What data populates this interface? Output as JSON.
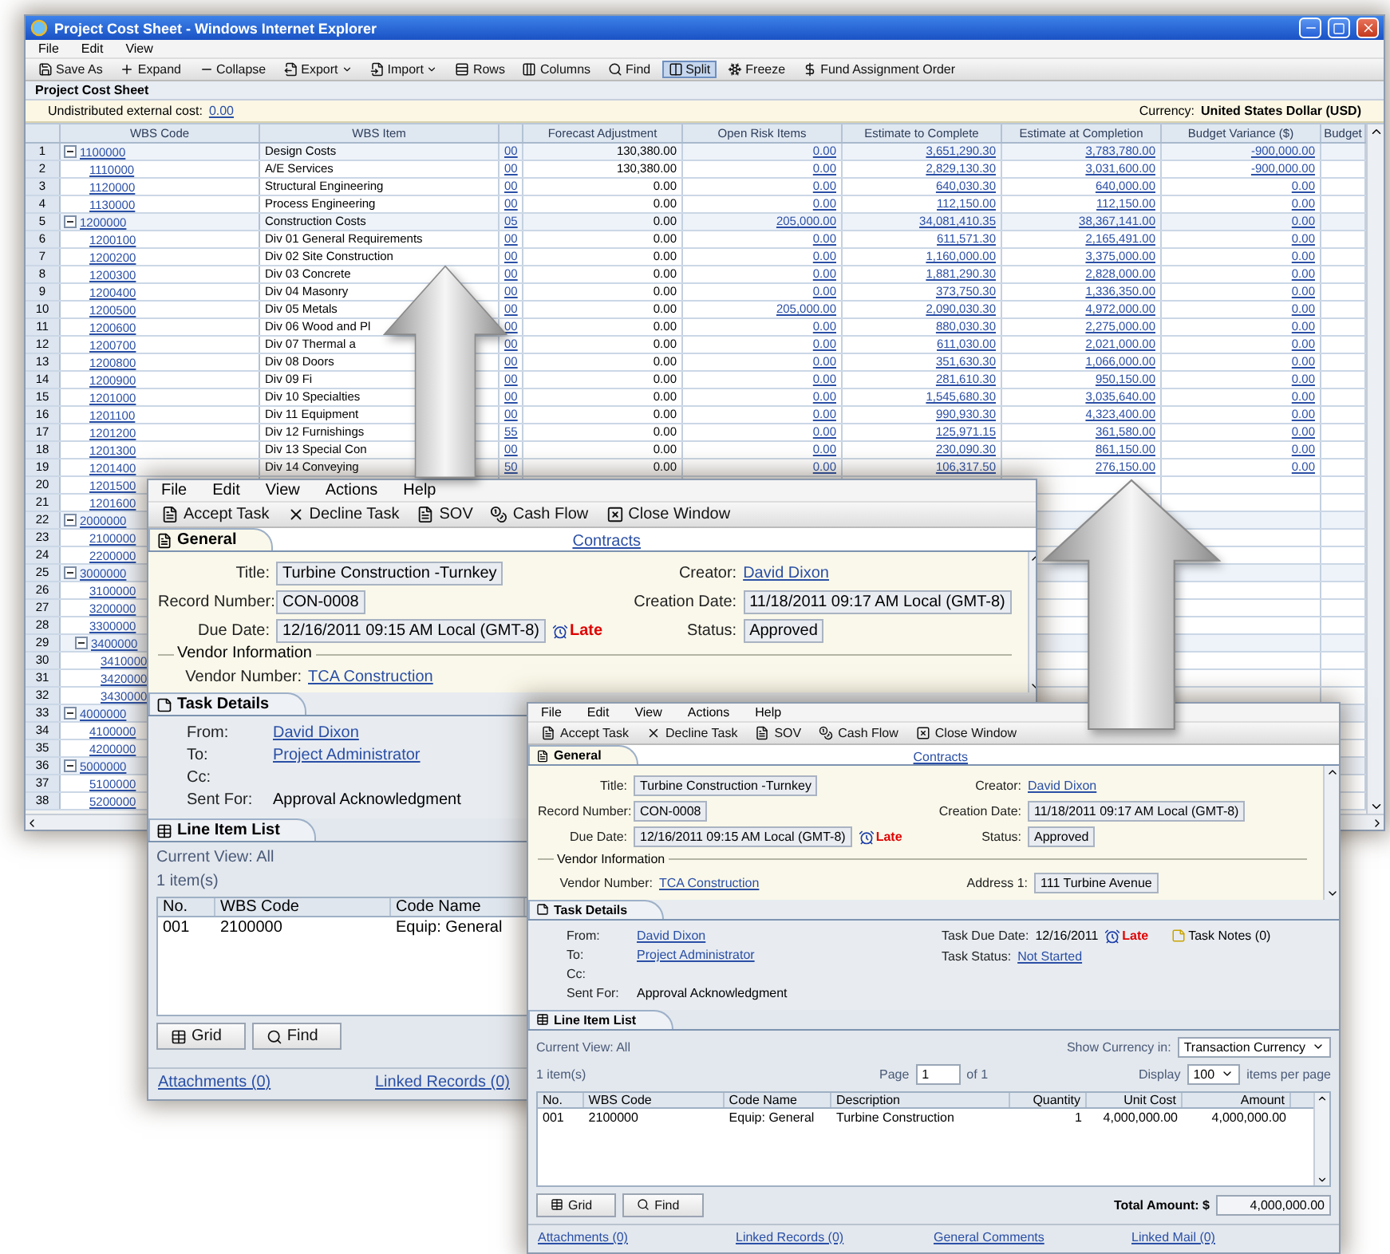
{
  "back_window": {
    "title": "Project Cost Sheet - Windows Internet Explorer",
    "menu": [
      "File",
      "Edit",
      "View"
    ],
    "toolbar": [
      {
        "label": "Save As",
        "dropdown": false,
        "selected": false
      },
      {
        "label": "Expand",
        "dropdown": false,
        "selected": false
      },
      {
        "label": "Collapse",
        "dropdown": false,
        "selected": false
      },
      {
        "label": "Export",
        "dropdown": true,
        "selected": false
      },
      {
        "label": "Import",
        "dropdown": true,
        "selected": false
      },
      {
        "label": "Rows",
        "dropdown": false,
        "selected": false
      },
      {
        "label": "Columns",
        "dropdown": false,
        "selected": false
      },
      {
        "label": "Find",
        "dropdown": false,
        "selected": false
      },
      {
        "label": "Split",
        "dropdown": false,
        "selected": true
      },
      {
        "label": "Freeze",
        "dropdown": false,
        "selected": false
      },
      {
        "label": "Fund Assignment Order",
        "dropdown": false,
        "selected": false
      }
    ],
    "heading": "Project Cost Sheet",
    "undistributed_label": "Undistributed external cost:",
    "undistributed_value": "0.00",
    "currency_label": "Currency:",
    "currency_value": "United States Dollar (USD)",
    "columns": [
      "WBS Code",
      "WBS Item",
      "Forecast Adjustment",
      "Open Risk Items",
      "Estimate to Complete",
      "Estimate at Completion",
      "Budget Variance ($)",
      "Budget"
    ],
    "rows": [
      {
        "number": "1",
        "code": "1100000",
        "expanded": true,
        "item": "Design Costs",
        "flag": "00",
        "values": [
          "130,380.00",
          "0.00",
          "3,651,290.30",
          "3,783,780.00",
          "-900,000.00"
        ],
        "children": [
          {
            "number": "2",
            "code": "1110000",
            "item": "A/E Services",
            "flag": "00",
            "values": [
              "130,380.00",
              "0.00",
              "2,829,130.30",
              "3,031,600.00",
              "-900,000.00"
            ]
          },
          {
            "number": "3",
            "code": "1120000",
            "item": "Structural Engineering",
            "flag": "00",
            "values": [
              "0.00",
              "0.00",
              "640,030.30",
              "640,000.00",
              "0.00"
            ]
          },
          {
            "number": "4",
            "code": "1130000",
            "item": "Process Engineering",
            "flag": "00",
            "values": [
              "0.00",
              "0.00",
              "112,150.00",
              "112,150.00",
              "0.00"
            ]
          }
        ]
      },
      {
        "number": "5",
        "code": "1200000",
        "expanded": true,
        "item": "Construction Costs",
        "flag": "05",
        "values": [
          "0.00",
          "205,000.00",
          "34,081,410.35",
          "38,367,141.00",
          "0.00"
        ],
        "children": [
          {
            "number": "6",
            "code": "1200100",
            "item": "Div 01 General Requirements",
            "flag": "00",
            "values": [
              "0.00",
              "0.00",
              "611,571.30",
              "2,165,491.00",
              "0.00"
            ]
          },
          {
            "number": "7",
            "code": "1200200",
            "item": "Div 02 Site Construction",
            "flag": "00",
            "values": [
              "0.00",
              "0.00",
              "1,160,000.00",
              "3,375,000.00",
              "0.00"
            ]
          },
          {
            "number": "8",
            "code": "1200300",
            "item": "Div 03 Concrete",
            "flag": "00",
            "values": [
              "0.00",
              "0.00",
              "1,881,290.30",
              "2,828,000.00",
              "0.00"
            ]
          },
          {
            "number": "9",
            "code": "1200400",
            "item": "Div 04 Masonry",
            "flag": "00",
            "values": [
              "0.00",
              "0.00",
              "373,750.30",
              "1,336,350.00",
              "0.00"
            ]
          },
          {
            "number": "10",
            "code": "1200500",
            "item": "Div 05 Metals",
            "flag": "00",
            "values": [
              "0.00",
              "205,000.00",
              "2,090,030.30",
              "4,972,000.00",
              "0.00"
            ]
          },
          {
            "number": "11",
            "code": "1200600",
            "item": "Div 06 Wood and Pl",
            "flag": "00",
            "values": [
              "0.00",
              "0.00",
              "880,030.30",
              "2,275,000.00",
              "0.00"
            ]
          },
          {
            "number": "12",
            "code": "1200700",
            "item": "Div 07 Thermal a",
            "flag": "00",
            "values": [
              "0.00",
              "0.00",
              "611,030.00",
              "2,021,000.00",
              "0.00"
            ]
          },
          {
            "number": "13",
            "code": "1200800",
            "item": "Div 08 Doors",
            "flag": "00",
            "values": [
              "0.00",
              "0.00",
              "351,630.30",
              "1,066,000.00",
              "0.00"
            ]
          },
          {
            "number": "14",
            "code": "1200900",
            "item": "Div 09 Fi",
            "flag": "00",
            "values": [
              "0.00",
              "0.00",
              "281,610.30",
              "950,150.00",
              "0.00"
            ]
          },
          {
            "number": "15",
            "code": "1201000",
            "item": "Div 10 Specialties",
            "flag": "00",
            "values": [
              "0.00",
              "0.00",
              "1,545,680.30",
              "3,035,640.00",
              "0.00"
            ]
          },
          {
            "number": "16",
            "code": "1201100",
            "item": "Div 11 Equipment",
            "flag": "00",
            "values": [
              "0.00",
              "0.00",
              "990,930.30",
              "4,323,400.00",
              "0.00"
            ]
          },
          {
            "number": "17",
            "code": "1201200",
            "item": "Div 12 Furnishings",
            "flag": "55",
            "values": [
              "0.00",
              "0.00",
              "125,971.15",
              "361,580.00",
              "0.00"
            ]
          },
          {
            "number": "18",
            "code": "1201300",
            "item": "Div 13 Special Con",
            "flag": "00",
            "values": [
              "0.00",
              "0.00",
              "230,090.30",
              "861,150.00",
              "0.00"
            ]
          },
          {
            "number": "19",
            "code": "1201400",
            "item": "Div 14 Conveying",
            "flag": "50",
            "values": [
              "0.00",
              "0.00",
              "106,317.50",
              "276,150.00",
              "0.00"
            ]
          },
          {
            "number": "20",
            "code": "1201500"
          },
          {
            "number": "21",
            "code": "1201600"
          }
        ]
      },
      {
        "number": "22",
        "code": "2000000",
        "expanded": true,
        "children": [
          {
            "number": "23",
            "code": "2100000"
          },
          {
            "number": "24",
            "code": "2200000"
          }
        ]
      },
      {
        "number": "25",
        "code": "3000000",
        "expanded": true,
        "children": [
          {
            "number": "26",
            "code": "3100000"
          },
          {
            "number": "27",
            "code": "3200000"
          },
          {
            "number": "28",
            "code": "3300000"
          },
          {
            "number": "29",
            "code": "3400000",
            "expanded": true,
            "children": [
              {
                "number": "30",
                "code": "3410000"
              },
              {
                "number": "31",
                "code": "3420000"
              },
              {
                "number": "32",
                "code": "3430000"
              }
            ]
          }
        ]
      },
      {
        "number": "33",
        "code": "4000000",
        "expanded": true,
        "children": [
          {
            "number": "34",
            "code": "4100000"
          },
          {
            "number": "35",
            "code": "4200000"
          }
        ]
      },
      {
        "number": "36",
        "code": "5000000",
        "expanded": true,
        "children": [
          {
            "number": "37",
            "code": "5100000"
          },
          {
            "number": "38",
            "code": "5200000"
          }
        ]
      }
    ]
  },
  "task_window": {
    "menu": [
      "File",
      "Edit",
      "View",
      "Actions",
      "Help"
    ],
    "toolbar": [
      "Accept Task",
      "Decline Task",
      "SOV",
      "Cash Flow",
      "Close Window"
    ],
    "general_title": "General",
    "contracts_link": "Contracts",
    "left_fields": [
      {
        "label": "Title:",
        "value": "Turbine Construction -Turnkey",
        "kind": "field"
      },
      {
        "label": "Record Number:",
        "value": "CON-0008",
        "kind": "field"
      },
      {
        "label": "Due Date:",
        "value": "12/16/2011 09:15 AM Local (GMT-8)",
        "kind": "field",
        "late": "Late"
      }
    ],
    "right_fields": [
      {
        "label": "Creator:",
        "value": "David Dixon",
        "kind": "link"
      },
      {
        "label": "Creation Date:",
        "value": "11/18/2011 09:17 AM Local (GMT-8)",
        "kind": "field"
      },
      {
        "label": "Status:",
        "value": "Approved",
        "kind": "field"
      }
    ],
    "vendor_legend": "Vendor Information",
    "vendor": [
      {
        "label": "Vendor Number:",
        "value": "TCA Construction",
        "kind": "link"
      }
    ],
    "task_title": "Task Details",
    "task_rows": [
      {
        "label": "From:",
        "value": "David Dixon",
        "kind": "link"
      },
      {
        "label": "To:",
        "value": "Project Administrator",
        "kind": "link"
      },
      {
        "label": "Cc:"
      },
      {
        "label": "Sent For:",
        "value": "Approval Acknowledgment",
        "kind": "text"
      }
    ],
    "line_title": "Line Item List",
    "current_view": "Current View: All",
    "count": "1 item(s)",
    "columns": [
      "No.",
      "WBS Code",
      "Code Name"
    ],
    "items": [
      [
        "001",
        "2100000",
        "Equip: General"
      ]
    ],
    "buttons": [
      "Grid",
      "Find"
    ],
    "links": [
      "Attachments (0)",
      "Linked Records (0)"
    ]
  },
  "front_window": {
    "menu": [
      "File",
      "Edit",
      "View",
      "Actions",
      "Help"
    ],
    "toolbar": [
      "Accept Task",
      "Decline Task",
      "SOV",
      "Cash Flow",
      "Close Window"
    ],
    "general_title": "General",
    "contracts_link": "Contracts",
    "left_fields": [
      {
        "label": "Title:",
        "value": "Turbine Construction -Turnkey",
        "kind": "field"
      },
      {
        "label": "Record Number:",
        "value": "CON-0008",
        "kind": "field"
      },
      {
        "label": "Due Date:",
        "value": "12/16/2011 09:15 AM Local (GMT-8)",
        "kind": "field",
        "late": "Late"
      }
    ],
    "right_fields": [
      {
        "label": "Creator:",
        "value": "David Dixon",
        "kind": "link"
      },
      {
        "label": "Creation Date:",
        "value": "11/18/2011 09:17 AM Local (GMT-8)",
        "kind": "field"
      },
      {
        "label": "Status:",
        "value": "Approved",
        "kind": "field"
      }
    ],
    "vendor_legend": "Vendor Information",
    "vendor": [
      {
        "label": "Vendor Number:",
        "value": "TCA Construction",
        "kind": "link"
      },
      {
        "label": "Address 1:",
        "value": "111 Turbine Avenue",
        "kind": "field"
      }
    ],
    "task_title": "Task Details",
    "task_rows": [
      {
        "label": "From:",
        "value": "David Dixon",
        "kind": "link"
      },
      {
        "label": "To:",
        "value": "Project Administrator",
        "kind": "link"
      },
      {
        "label": "Cc:"
      },
      {
        "label": "Sent For:",
        "value": "Approval Acknowledgment",
        "kind": "text"
      }
    ],
    "task_side": [
      {
        "label": "Task Due Date:",
        "value": "12/16/2011",
        "kind": "text",
        "late": "Late"
      },
      {
        "label": "Task Status:",
        "value": "Not Started",
        "kind": "link"
      }
    ],
    "task_notes": "Task Notes (0)",
    "line_title": "Line Item List",
    "current_view": "Current View: All",
    "currency_label": "Show Currency in:",
    "currency_value": "Transaction Currency",
    "count": "1 item(s)",
    "page_label": "Page",
    "page_value": "1",
    "page_of": "of 1",
    "display_label": "Display",
    "display_value": "100",
    "per_page": "items per page",
    "columns": [
      "No.",
      "WBS Code",
      "Code Name",
      "Description",
      "Quantity",
      "Unit Cost",
      "Amount"
    ],
    "items": [
      [
        "001",
        "2100000",
        "Equip: General",
        "Turbine Construction",
        "1",
        "4,000,000.00",
        "4,000,000.00"
      ]
    ],
    "buttons": [
      "Grid",
      "Find"
    ],
    "total_label": "Total Amount: $",
    "total_value": "4,000,000.00",
    "links": [
      "Attachments (0)",
      "Linked Records (0)",
      "General Comments",
      "Linked Mail (0)"
    ]
  }
}
